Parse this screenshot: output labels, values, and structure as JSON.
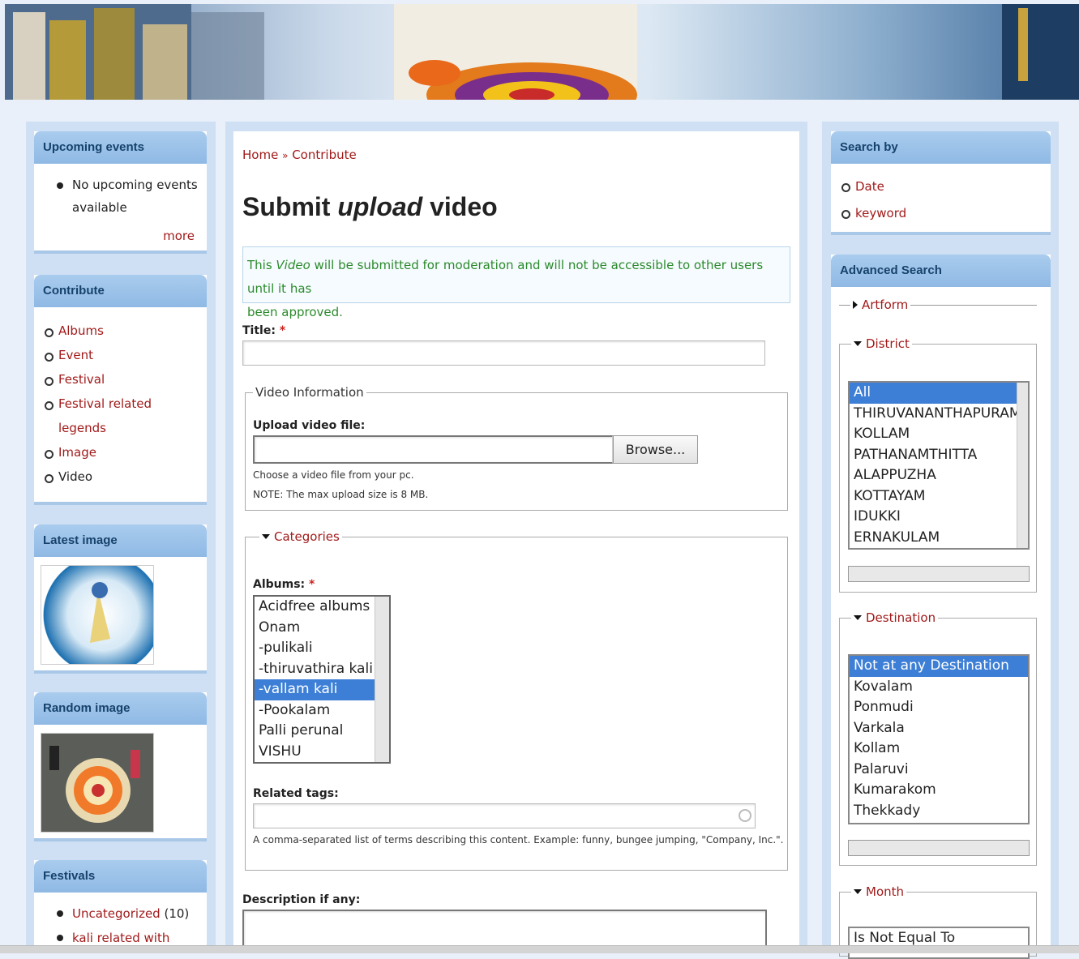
{
  "left": {
    "upcoming": {
      "title": "Upcoming events",
      "item_line1": "No upcoming events",
      "item_line2": "available",
      "more": "more"
    },
    "contribute": {
      "title": "Contribute",
      "items": [
        "Albums",
        "Event",
        "Festival",
        "Festival related",
        "legends",
        "Image",
        "Video"
      ]
    },
    "latest_image": {
      "title": "Latest image"
    },
    "random_image": {
      "title": "Random image"
    },
    "festivals": {
      "title": "Festivals",
      "item1": "Uncategorized",
      "item1_count": "(10)",
      "item2": "kali related with"
    }
  },
  "main": {
    "breadcrumb": {
      "home": "Home",
      "sep": "»",
      "current": "Contribute"
    },
    "title": {
      "part1": "Submit ",
      "part2": "upload",
      "part3": " video"
    },
    "notice": {
      "prefix": "This ",
      "emph": "Video",
      "line1_rest": " will be submitted for moderation and will not be accessible to other users until it has",
      "line2": "been approved."
    },
    "title_label": "Title:",
    "req": "*",
    "video_info": {
      "legend": "Video Information",
      "upload_label": "Upload video file:",
      "browse": "Browse...",
      "help1": "Choose a video file from your pc.",
      "help2_strong": "NOTE:",
      "help2": " The max upload size is 8 MB."
    },
    "categories": {
      "legend": "Categories",
      "albums_label": "Albums:",
      "albums": [
        "Acidfree albums",
        "Onam",
        "-pulikali",
        "-thiruvathira kali",
        "-vallam kali",
        "-Pookalam",
        "Palli perunal",
        "VISHU"
      ],
      "selected_album": "-vallam kali",
      "tags_label": "Related tags:",
      "tags_help": "A comma-separated list of terms describing this content. Example: funny, bungee jumping, \"Company, Inc.\"."
    },
    "description_label": "Description if any:"
  },
  "right": {
    "search_by": {
      "title": "Search by",
      "items": [
        "Date",
        "keyword"
      ]
    },
    "advanced": {
      "title": "Advanced Search",
      "artform": "Artform",
      "district": {
        "legend": "District",
        "options": [
          "All",
          "THIRUVANANTHAPURAM",
          "KOLLAM",
          "PATHANAMTHITTA",
          "ALAPPUZHA",
          "KOTTAYAM",
          "IDUKKI",
          "ERNAKULAM"
        ]
      },
      "destination": {
        "legend": "Destination",
        "options": [
          "Not at any Destination",
          "Kovalam",
          "Ponmudi",
          "Varkala",
          "Kollam",
          "Palaruvi",
          "Kumarakom",
          "Thekkady"
        ]
      },
      "month": {
        "legend": "Month",
        "first_option": "Is Not Equal To"
      }
    }
  },
  "colors": {
    "link": "#a11a1a",
    "header_block": "#8fb9e4",
    "selected": "#3d7fd6",
    "notice_text": "#2b8a2b"
  }
}
